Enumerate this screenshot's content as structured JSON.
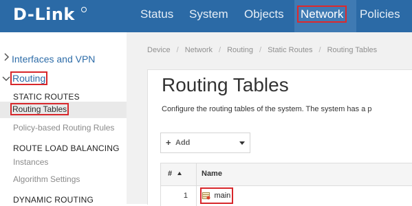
{
  "brand": {
    "logo_text": "D-Link"
  },
  "topnav": {
    "items": [
      {
        "label": "Status"
      },
      {
        "label": "System"
      },
      {
        "label": "Objects"
      },
      {
        "label": "Network"
      },
      {
        "label": "Policies"
      }
    ],
    "active": "Network"
  },
  "sidebar": {
    "interfaces_label": "Interfaces and VPN",
    "routing_label": "Routing",
    "static_routes_heading": "STATIC ROUTES",
    "routing_tables_label": "Routing Tables",
    "policy_routing_label": "Policy-based Routing Rules",
    "load_balancing_heading": "ROUTE LOAD BALANCING",
    "instances_label": "Instances",
    "algorithm_label": "Algorithm Settings",
    "dynamic_routing_heading": "DYNAMIC ROUTING"
  },
  "breadcrumb": [
    "Device",
    "Network",
    "Routing",
    "Static Routes",
    "Routing Tables"
  ],
  "main": {
    "title": "Routing Tables",
    "description": "Configure the routing tables of the system. The system has a p",
    "add_button_label": "Add",
    "add_icon": "plus-icon"
  },
  "table": {
    "columns": [
      {
        "label": "#"
      },
      {
        "label": "Name"
      }
    ],
    "sort_icon": "sort-ascending-icon",
    "rows": [
      {
        "num": "1",
        "name": "main",
        "icon": "routing-table-icon"
      }
    ]
  },
  "colors": {
    "topbar": "#2b6aa6",
    "active_tab": "#3f7ab3",
    "highlight": "#d7262a",
    "link": "#2d6ca8"
  }
}
